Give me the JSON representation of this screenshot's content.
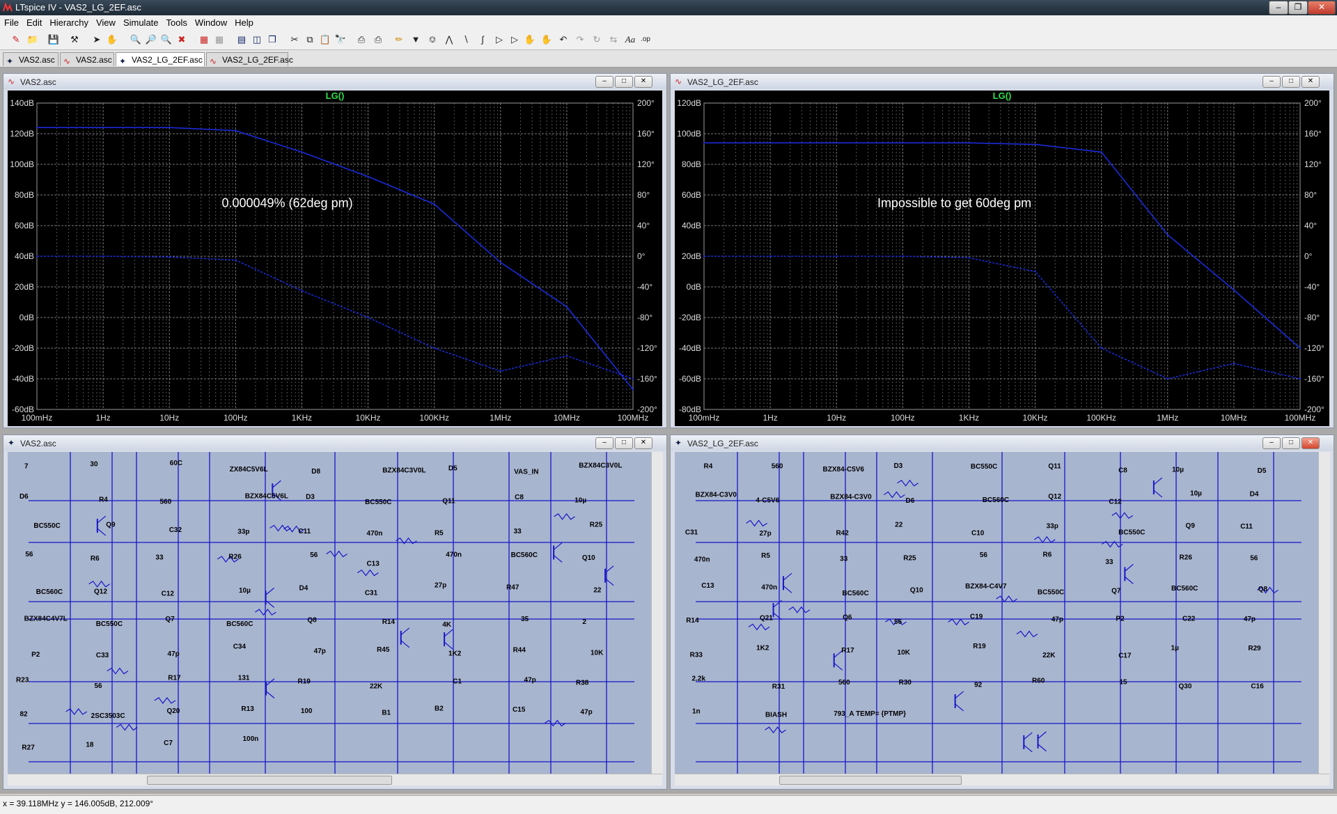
{
  "app": {
    "title": "LTspice IV - VAS2_LG_2EF.asc"
  },
  "menu": [
    "File",
    "Edit",
    "Hierarchy",
    "View",
    "Simulate",
    "Tools",
    "Window",
    "Help"
  ],
  "tabs": [
    {
      "label": "VAS2.asc",
      "icon": "schematic-icon"
    },
    {
      "label": "VAS2.asc",
      "icon": "waveform-icon"
    },
    {
      "label": "VAS2_LG_2EF.asc",
      "icon": "schematic-icon"
    },
    {
      "label": "VAS2_LG_2EF.asc",
      "icon": "waveform-icon"
    }
  ],
  "plot_left": {
    "title": "VAS2.asc",
    "trace": "LG()",
    "annotation": "0.000049% (62deg pm)",
    "db_ticks": [
      "140dB",
      "120dB",
      "100dB",
      "80dB",
      "60dB",
      "40dB",
      "20dB",
      "0dB",
      "-20dB",
      "-40dB",
      "-60dB"
    ],
    "deg_ticks": [
      "200°",
      "160°",
      "120°",
      "80°",
      "40°",
      "0°",
      "-40°",
      "-80°",
      "-120°",
      "-160°",
      "-200°"
    ],
    "freq_ticks": [
      "100mHz",
      "1Hz",
      "10Hz",
      "100Hz",
      "1KHz",
      "10KHz",
      "100KHz",
      "1MHz",
      "10MHz",
      "100MHz"
    ]
  },
  "plot_right": {
    "title": "VAS2_LG_2EF.asc",
    "trace": "LG()",
    "annotation": "Impossible to get 60deg pm",
    "db_ticks": [
      "120dB",
      "100dB",
      "80dB",
      "60dB",
      "40dB",
      "20dB",
      "0dB",
      "-20dB",
      "-40dB",
      "-60dB",
      "-80dB"
    ],
    "deg_ticks": [
      "200°",
      "160°",
      "120°",
      "80°",
      "40°",
      "0°",
      "-40°",
      "-80°",
      "-120°",
      "-160°",
      "-200°"
    ],
    "freq_ticks": [
      "100mHz",
      "1Hz",
      "10Hz",
      "100Hz",
      "1KHz",
      "10KHz",
      "100KHz",
      "1MHz",
      "10MHz",
      "100MHz"
    ]
  },
  "chart_data": [
    {
      "type": "line",
      "title": "LG()",
      "x": [
        "100mHz",
        "1Hz",
        "10Hz",
        "100Hz",
        "1KHz",
        "10KHz",
        "100KHz",
        "1MHz",
        "10MHz",
        "100MHz"
      ],
      "series": [
        {
          "name": "LG() magnitude",
          "axis": "dB",
          "values": [
            124,
            124,
            124,
            122,
            108,
            92,
            74,
            36,
            7,
            -47
          ]
        },
        {
          "name": "LG() phase",
          "axis": "deg",
          "values": [
            0,
            0,
            -1,
            -5,
            -45,
            -80,
            -120,
            -150,
            -130,
            -160
          ]
        }
      ],
      "ylim_db": [
        -60,
        140
      ],
      "ylim_deg": [
        -200,
        200
      ],
      "grid": true
    },
    {
      "type": "line",
      "title": "LG()",
      "x": [
        "100mHz",
        "1Hz",
        "10Hz",
        "100Hz",
        "1KHz",
        "10KHz",
        "100KHz",
        "1MHz",
        "10MHz",
        "100MHz"
      ],
      "series": [
        {
          "name": "LG() magnitude",
          "axis": "dB",
          "values": [
            94,
            94,
            94,
            94,
            94,
            93,
            88,
            34,
            -2,
            -40
          ]
        },
        {
          "name": "LG() phase",
          "axis": "deg",
          "values": [
            0,
            0,
            0,
            0,
            -2,
            -20,
            -120,
            -160,
            -140,
            -160
          ]
        }
      ],
      "ylim_db": [
        -80,
        120
      ],
      "ylim_deg": [
        -200,
        200
      ],
      "grid": true
    }
  ],
  "schem_left": {
    "title": "VAS2.asc",
    "labels": [
      "7",
      "30",
      "60C",
      "ZX84C5V6L",
      "D8",
      "BZX84C3V0L",
      "D5",
      "VAS_IN",
      "BZX84C3V0L",
      "D6",
      "R4",
      "560",
      "BZX84C5V6L",
      "D3",
      "BC550C",
      "Q11",
      "C8",
      "10µ",
      "BC550C",
      "Q9",
      "C32",
      "33p",
      "C11",
      "470n",
      "R5",
      "33",
      "R25",
      "56",
      "R6",
      "33",
      "R26",
      "56",
      "C13",
      "470n",
      "BC560C",
      "Q10",
      "BC560C",
      "Q12",
      "C12",
      "10µ",
      "D4",
      "C31",
      "27p",
      "R47",
      "22",
      "BZX84C4V7L",
      "BC550C",
      "Q7",
      "BC560C",
      "Q8",
      "R14",
      "4K",
      "35",
      "2",
      "P2",
      "C33",
      "47p",
      "C34",
      "47p",
      "R45",
      "1K2",
      "R44",
      "10K",
      "R23",
      "56",
      "R17",
      "131",
      "R19",
      "22K",
      "C1",
      "47p",
      "R38",
      "82",
      "2SC3503C",
      "Q20",
      "R13",
      "100",
      "B1",
      "B2",
      "C15",
      "47p",
      "R27",
      "18",
      "C7",
      "100n"
    ]
  },
  "schem_right": {
    "title": "VAS2_LG_2EF.asc",
    "labels": [
      "R4",
      "560",
      "BZX84-C5V6",
      "D3",
      "BC550C",
      "Q11",
      "C8",
      "10µ",
      "D5",
      "BZX84-C3V0",
      "4-C5V6",
      "BZX84-C3V0",
      "D6",
      "BC560C",
      "Q12",
      "C12",
      "10µ",
      "D4",
      "C31",
      "27p",
      "R42",
      "22",
      "C10",
      "33p",
      "BC550C",
      "Q9",
      "C11",
      "470n",
      "R5",
      "33",
      "R25",
      "56",
      "R6",
      "33",
      "R26",
      "56",
      "C13",
      "470n",
      "BC560C",
      "Q10",
      "BZX84-C4V7",
      "BC550C",
      "Q7",
      "BC560C",
      "Q8",
      "R14",
      "Q21",
      "Q6",
      "56",
      "C19",
      "47p",
      "P2",
      "C22",
      "47p",
      "R33",
      "1K2",
      "R17",
      "10K",
      "R19",
      "22K",
      "C17",
      "1µ",
      "R29",
      "2.2k",
      "R31",
      "560",
      "R30",
      "92",
      "R60",
      "15",
      "Q30",
      "C16",
      "1n",
      "BIASH",
      "793_A TEMP= {PTMP}"
    ]
  },
  "status": {
    "text": "x = 39.118MHz    y = 146.005dB, 212.009°"
  },
  "colors": {
    "trace": "#1a2bd8",
    "grid": "#666666",
    "schematic_wire": "#1616c8",
    "schematic_bg": "#a8b5cf"
  }
}
